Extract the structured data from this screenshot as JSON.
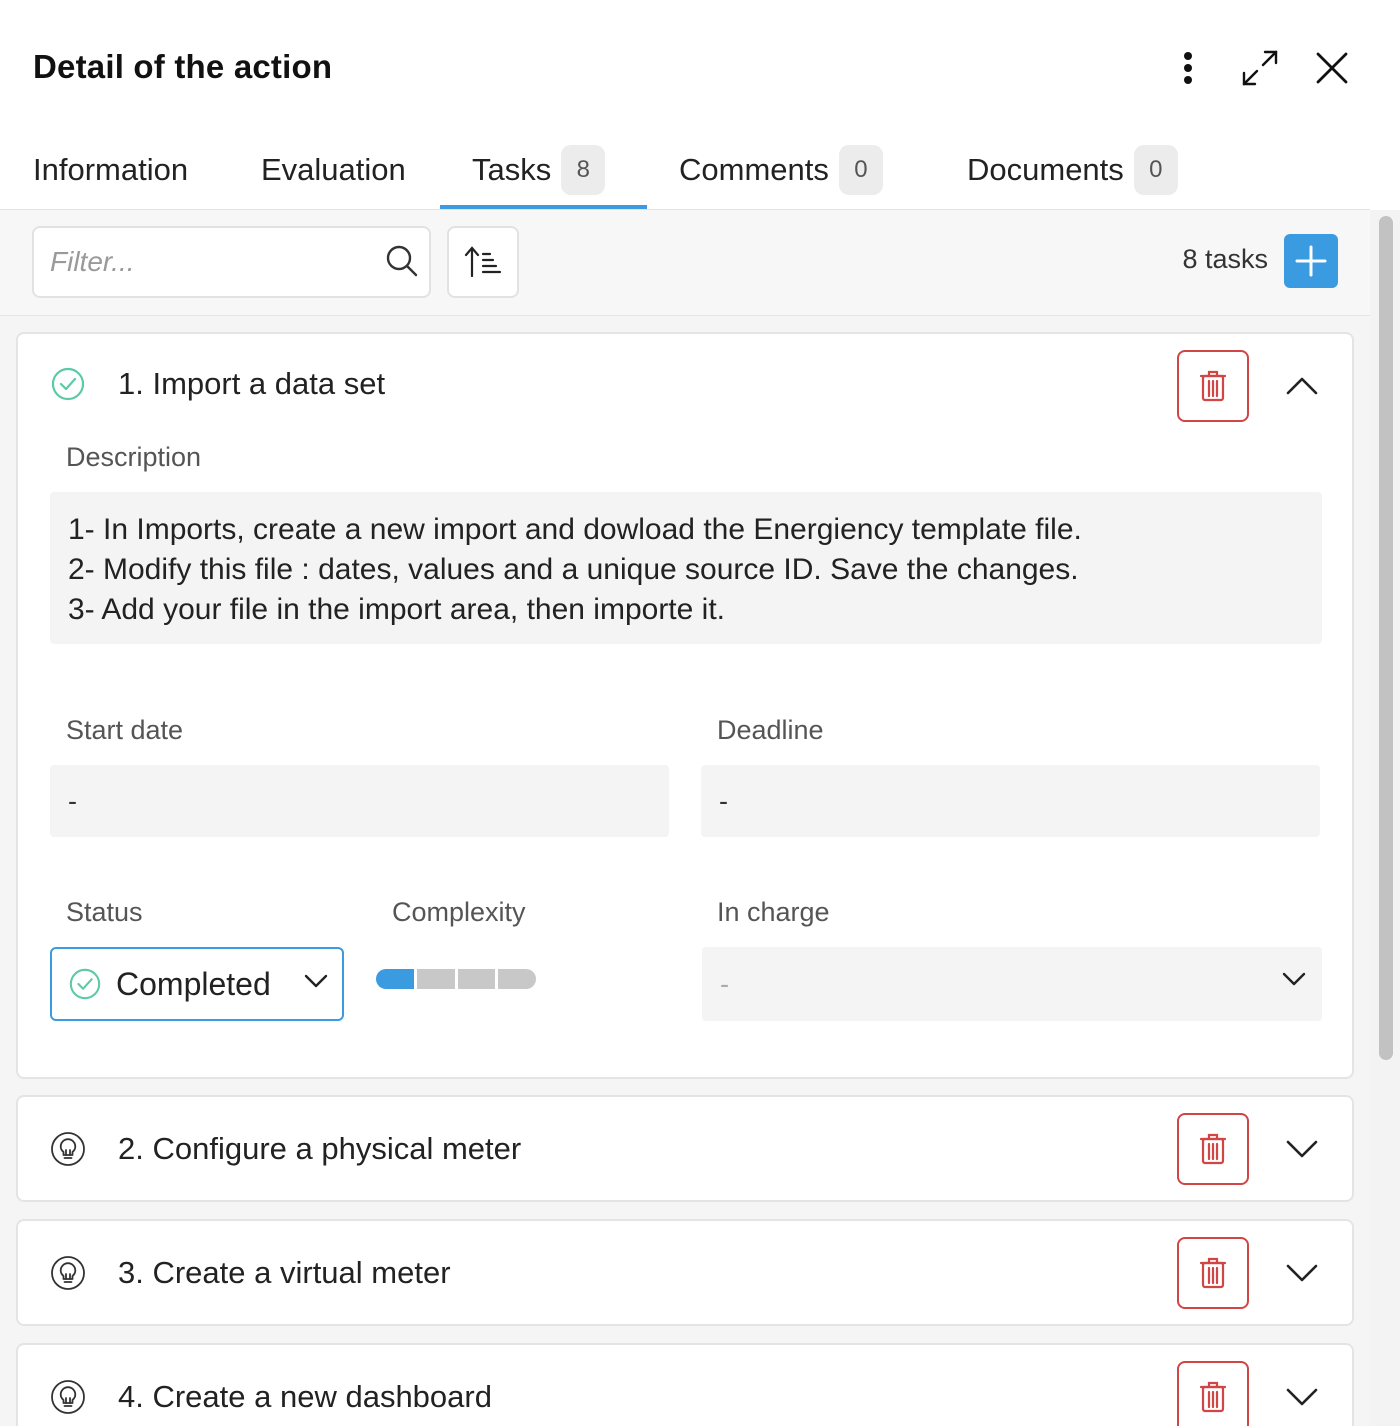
{
  "header": {
    "title": "Detail of the action",
    "more_icon": "more-vertical-icon",
    "expand_icon": "expand-icon",
    "close_icon": "close-icon"
  },
  "tabs": [
    {
      "label": "Information",
      "badge": ""
    },
    {
      "label": "Evaluation",
      "badge": ""
    },
    {
      "label": "Tasks",
      "badge": "8"
    },
    {
      "label": "Comments",
      "badge": "0"
    },
    {
      "label": "Documents",
      "badge": "0"
    }
  ],
  "active_tab": "Tasks",
  "toolbar": {
    "filter_placeholder": "Filter...",
    "filter_value": "",
    "task_count": "8 tasks"
  },
  "colors": {
    "accent": "#3a9be0",
    "delete": "#d24545",
    "completed": "#5cc9a7"
  },
  "tasks": [
    {
      "title": "1. Import a data set",
      "status_icon": "check-circle-icon",
      "expanded": true,
      "description_label": "Description",
      "description": [
        "1- In Imports, create a new import and dowload the Energiency template file.",
        "2- Modify this file : dates, values and a unique source ID. Save the changes.",
        "3- Add your file in the import area, then importe it."
      ],
      "start_date_label": "Start date",
      "start_date": "-",
      "deadline_label": "Deadline",
      "deadline": "-",
      "status_label": "Status",
      "status": "Completed",
      "complexity_label": "Complexity",
      "complexity_level": 1,
      "complexity_max": 4,
      "in_charge_label": "In charge",
      "in_charge": "-"
    },
    {
      "title": "2. Configure a physical meter",
      "status_icon": "lightbulb-icon",
      "expanded": false
    },
    {
      "title": "3. Create a virtual meter",
      "status_icon": "lightbulb-icon",
      "expanded": false
    },
    {
      "title": "4. Create a new dashboard",
      "status_icon": "lightbulb-icon",
      "expanded": false
    }
  ]
}
